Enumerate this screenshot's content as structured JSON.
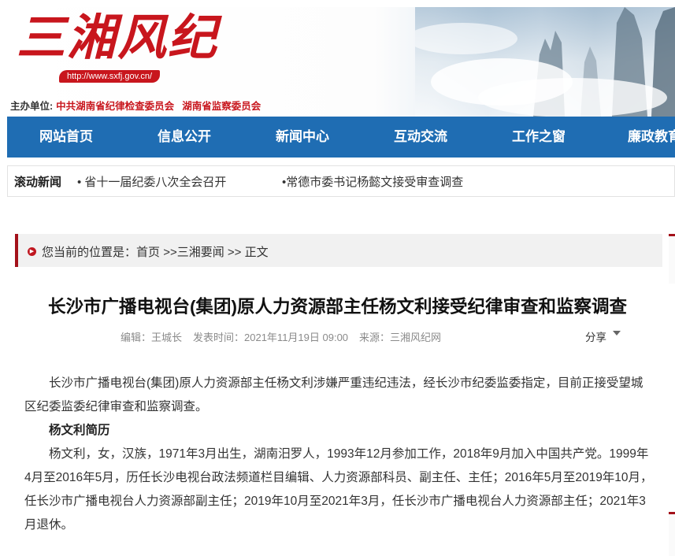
{
  "header": {
    "logo_text": "三湘风纪",
    "url": "http://www.sxfj.gov.cn/",
    "sponsor_label": "主办单位:",
    "sponsor_org1": "中共湖南省纪律检查委员会",
    "sponsor_org2": "湖南省监察委员会"
  },
  "nav": {
    "items": [
      "网站首页",
      "信息公开",
      "新闻中心",
      "互动交流",
      "工作之窗",
      "廉政教育"
    ]
  },
  "scroll_news": {
    "label": "滚动新闻",
    "items": [
      "• 省十一届纪委八次全会召开",
      "•常德市委书记杨懿文接受审查调查"
    ]
  },
  "breadcrumb": {
    "prefix": "您当前的位置是：",
    "home": "首页",
    "sep1": " >>",
    "section": "三湘要闻",
    "sep2": " >> ",
    "current": "正文"
  },
  "article": {
    "title": "长沙市广播电视台(集团)原人力资源部主任杨文利接受纪律审查和监察调查",
    "editor": "编辑：王城长",
    "time": "发表时间：2021年11月19日 09:00",
    "source": "来源：三湘风纪网",
    "share": "分享",
    "para1": "长沙市广播电视台(集团)原人力资源部主任杨文利涉嫌严重违纪违法，经长沙市纪委监委指定，目前正接受望城区纪委监委纪律审查和监察调查。",
    "subtitle": "杨文利简历",
    "para2": "杨文利，女，汉族，1971年3月出生，湖南汨罗人，1993年12月参加工作，2018年9月加入中国共产党。1999年4月至2016年5月，历任长沙电视台政法频道栏目编辑、人力资源部科员、副主任、主任；2016年5月至2019年10月，任长沙市广播电视台人力资源部副主任；2019年10月至2021年3月，任长沙市广播电视台人力资源部主任；2021年3月退休。"
  },
  "colors": {
    "brand_red": "#c8161d",
    "nav_blue": "#1f6db3",
    "crumb_accent": "#a3111a"
  }
}
